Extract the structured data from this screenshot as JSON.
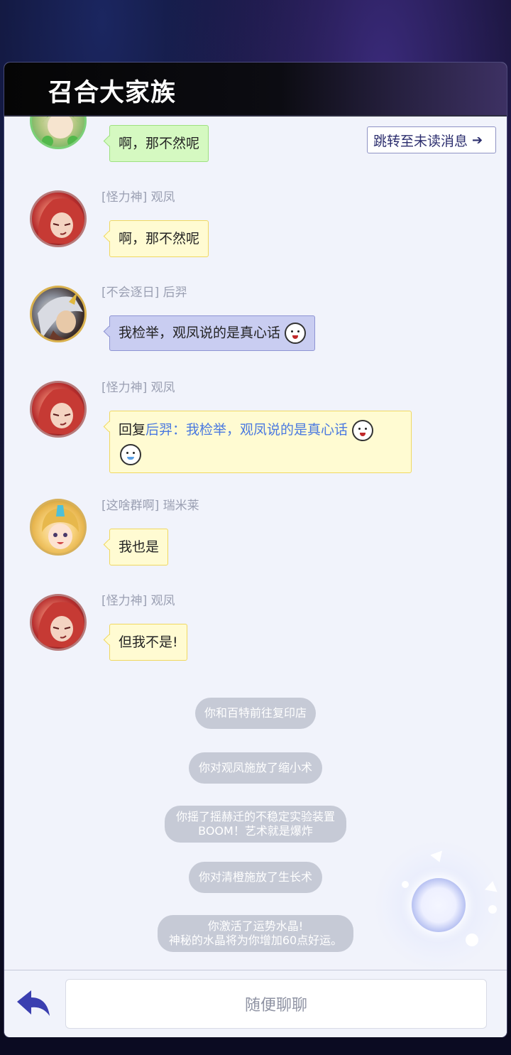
{
  "header": {
    "title": "召合大家族"
  },
  "jump_button": {
    "label": "跳转至未读消息",
    "arrow_icon": "chevron-right-icon"
  },
  "messages": [
    {
      "sender": "",
      "avatar": "green-haired-character-avatar",
      "text": "啊，那不然呢",
      "bubble_color": "#d5f9c1"
    },
    {
      "sender": "[怪力神] 观凤",
      "avatar": "red-haired-character-avatar",
      "text": "啊，那不然呢",
      "bubble_color": "#fffbd2"
    },
    {
      "sender": "[不会逐日] 后羿",
      "avatar": "armored-archer-avatar",
      "text": "我检举，观凤说的是真心话",
      "bubble_color": "#c9cdf1",
      "emoji": "laughing-face-emoji"
    },
    {
      "sender": "[怪力神] 观凤",
      "avatar": "red-haired-character-avatar",
      "reply_prefix": "回复",
      "reply_quote": "后羿：我检举，观凤说的是真心话",
      "bubble_color": "#fffbd2",
      "emojis": [
        "laughing-face-emoji",
        "hammer-face-emoji"
      ]
    },
    {
      "sender": "[这啥群啊] 瑞米莱",
      "avatar": "blonde-helmet-character-avatar",
      "text": "我也是",
      "bubble_color": "#fffbd2"
    },
    {
      "sender": "[怪力神] 观凤",
      "avatar": "red-haired-character-avatar",
      "text": "但我不是!",
      "bubble_color": "#fffbd2"
    }
  ],
  "system_messages": [
    {
      "lines": [
        "你和百特前往复印店"
      ]
    },
    {
      "lines": [
        "你对观凤施放了缩小术"
      ]
    },
    {
      "lines": [
        "你摇了摇赫迁的不稳定实验装置",
        "BOOM！艺术就是爆炸"
      ]
    },
    {
      "lines": [
        "你对清橙施放了生长术"
      ]
    },
    {
      "lines": [
        "你激活了运势水晶!",
        "神秘的水晶将为你增加60点好运。"
      ]
    }
  ],
  "footer": {
    "back_icon": "back-arrow-icon",
    "input_placeholder": "随便聊聊"
  },
  "colors": {
    "accent": "#3b3fb0",
    "reply_link": "#4a79e0",
    "system_pill": "#c6cad6"
  }
}
